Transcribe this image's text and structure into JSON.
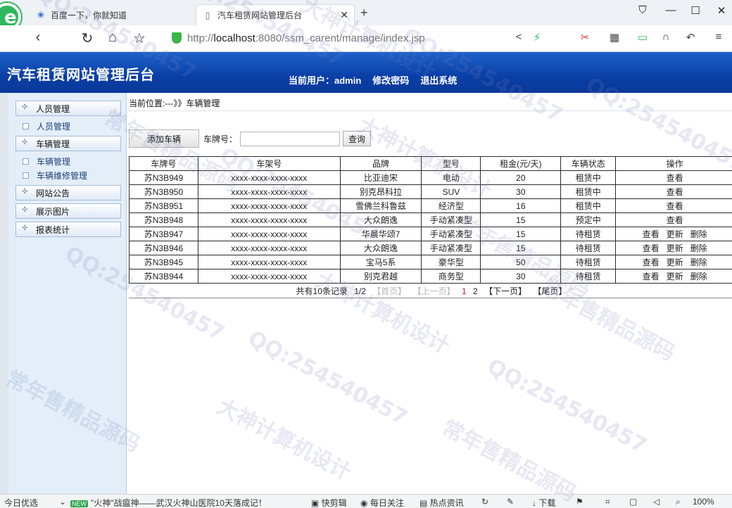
{
  "browser": {
    "tabs": [
      {
        "label": "百度一下，你就知道",
        "icon": "baidu-paw-icon"
      },
      {
        "label": "汽车租赁网站管理后台",
        "icon": "page-icon"
      }
    ],
    "url_prefix": "http://",
    "url_host": "localhost",
    "url_rest": ":8080/ssm_carent/manage/index.jsp"
  },
  "app": {
    "title": "汽车租赁网站管理后台",
    "current_user_label": "当前用户：admin",
    "change_password": "修改密码",
    "logout": "退出系统"
  },
  "sidebar": {
    "items": [
      {
        "label": "人员管理",
        "type": "group"
      },
      {
        "label": "人员管理",
        "type": "sub"
      },
      {
        "label": "车辆管理",
        "type": "group"
      },
      {
        "label": "车辆管理",
        "type": "sub"
      },
      {
        "label": "车辆维修管理",
        "type": "sub"
      },
      {
        "label": "网站公告",
        "type": "group"
      },
      {
        "label": "展示图片",
        "type": "group"
      },
      {
        "label": "报表统计",
        "type": "group"
      }
    ]
  },
  "main": {
    "breadcrumb": "当前位置:---》》车辆管理",
    "add_button": "添加车辆",
    "plate_label": "车牌号：",
    "plate_value": "",
    "query_button": "查询",
    "columns": [
      "车牌号",
      "车架号",
      "品牌",
      "型号",
      "租金(元/天)",
      "车辆状态",
      "操作"
    ],
    "rows": [
      {
        "plate": "苏N3B949",
        "vin": "xxxx-xxxx-xxxx-xxxx",
        "brand": "比亚迪宋",
        "model": "电动",
        "rent": "20",
        "status": "租赁中",
        "ops": [
          "查看"
        ]
      },
      {
        "plate": "苏N3B950",
        "vin": "xxxx-xxxx-xxxx-xxxx",
        "brand": "别克昂科拉",
        "model": "SUV",
        "rent": "30",
        "status": "租赁中",
        "ops": [
          "查看"
        ]
      },
      {
        "plate": "苏N3B951",
        "vin": "xxxx-xxxx-xxxx-xxxx",
        "brand": "雪佛兰科鲁兹",
        "model": "经济型",
        "rent": "16",
        "status": "租赁中",
        "ops": [
          "查看"
        ]
      },
      {
        "plate": "苏N3B948",
        "vin": "xxxx-xxxx-xxxx-xxxx",
        "brand": "大众朗逸",
        "model": "手动紧凑型",
        "rent": "15",
        "status": "预定中",
        "ops": [
          "查看"
        ]
      },
      {
        "plate": "苏N3B947",
        "vin": "xxxx-xxxx-xxxx-xxxx",
        "brand": "华晨华颂7",
        "model": "手动紧凑型",
        "rent": "15",
        "status": "待租赁",
        "ops": [
          "查看",
          "更新",
          "删除"
        ]
      },
      {
        "plate": "苏N3B946",
        "vin": "xxxx-xxxx-xxxx-xxxx",
        "brand": "大众朗逸",
        "model": "手动紧凑型",
        "rent": "15",
        "status": "待租赁",
        "ops": [
          "查看",
          "更新",
          "删除"
        ]
      },
      {
        "plate": "苏N3B945",
        "vin": "xxxx-xxxx-xxxx-xxxx",
        "brand": "宝马5系",
        "model": "豪华型",
        "rent": "50",
        "status": "待租赁",
        "ops": [
          "查看",
          "更新",
          "删除"
        ]
      },
      {
        "plate": "苏N3B944",
        "vin": "xxxx-xxxx-xxxx-xxxx",
        "brand": "别克君越",
        "model": "商务型",
        "rent": "30",
        "status": "待租赁",
        "ops": [
          "查看",
          "更新",
          "删除"
        ]
      }
    ],
    "pager": {
      "total": "共有10条记录",
      "page": "1/2",
      "first": "【首页】",
      "prev": "【上一页】",
      "p1": "1",
      "p2": "2",
      "next": "【下一页】",
      "last": "【尾页】"
    }
  },
  "statusbar": {
    "today": "今日优选",
    "new_tag": "NEW",
    "news": "\"火神\"战瘟神——武汉火神山医院10天落成记！",
    "clip": "快剪辑",
    "follow": "每日关注",
    "hot": "热点资讯",
    "download": "下载",
    "zoom": "100%"
  },
  "watermarks": [
    "QQ:254540457",
    "常年售精品源码",
    "大神计算机设计"
  ]
}
